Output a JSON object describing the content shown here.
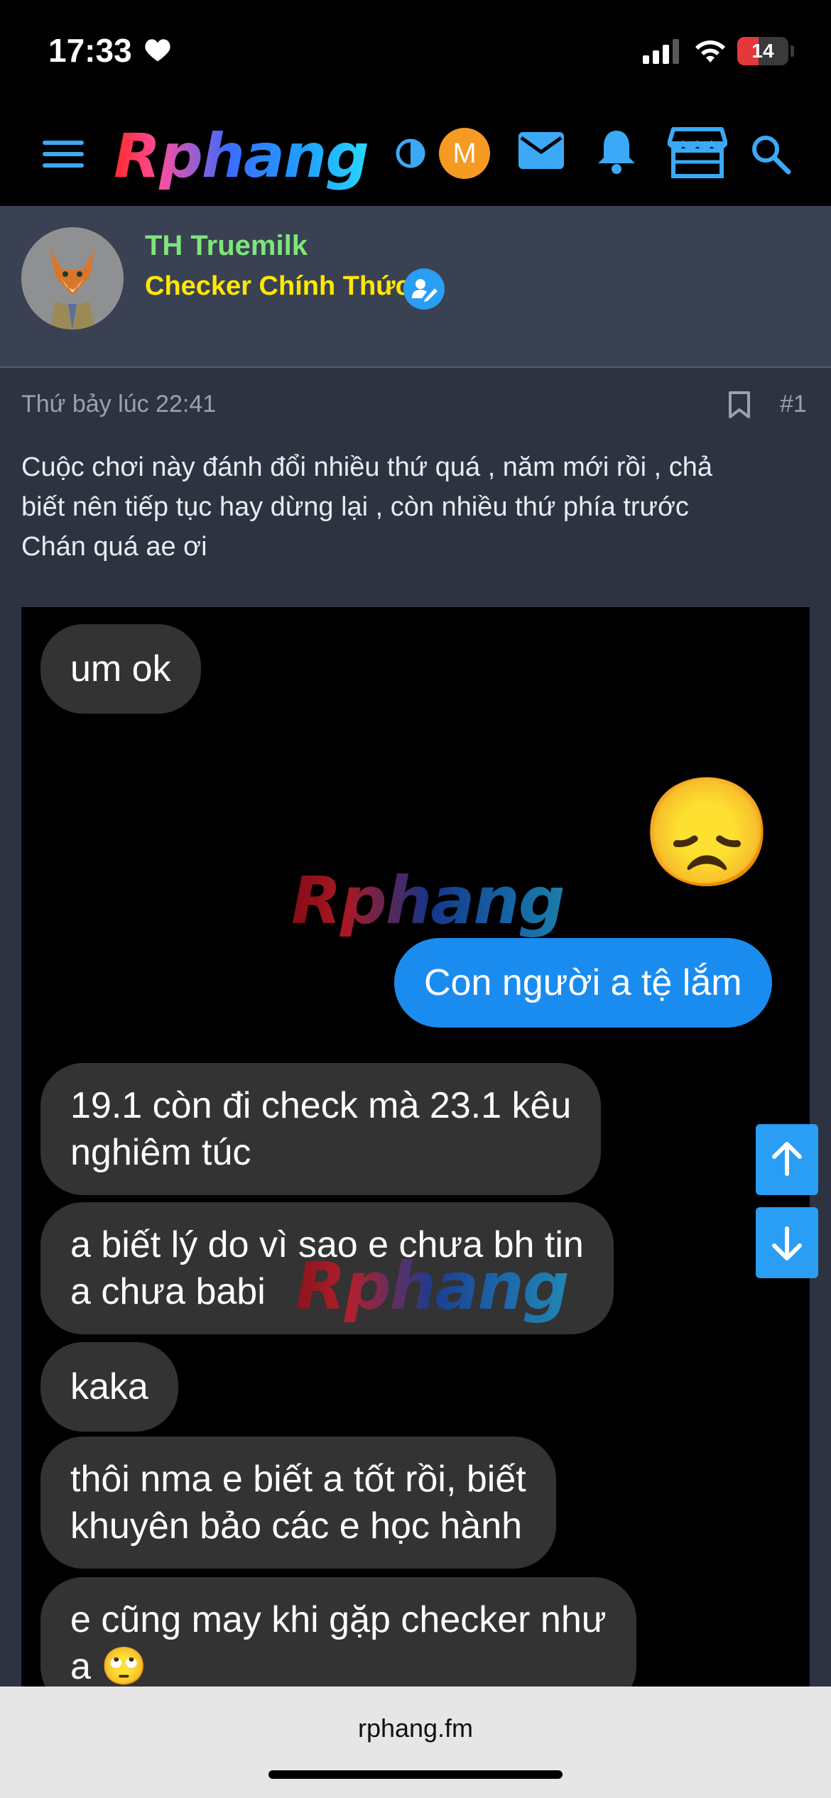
{
  "status_bar": {
    "time": "17:33",
    "battery": "14",
    "battery_level": 0.14
  },
  "header": {
    "logo": "Rphang",
    "user_avatar_letter": "M",
    "icons": [
      "menu-icon",
      "theme-toggle-icon",
      "mail-icon",
      "bell-icon",
      "store-icon",
      "search-icon"
    ]
  },
  "user": {
    "name": "TH Truemilk",
    "role": "Checker Chính Thức"
  },
  "post": {
    "timestamp": "Thứ bảy lúc 22:41",
    "number": "#1",
    "text_lines": [
      "Cuộc chơi này đánh đổi nhiều thứ quá , năm mới rồi , chả",
      "biết nên tiếp tục hay dừng lại , còn nhiều thứ phía trước",
      "Chán quá ae ơi"
    ]
  },
  "chat": {
    "received_1": "um ok",
    "sticker": "😞",
    "sent_1": "Con người a tệ lắm",
    "received_2_line1": "19.1 còn đi check mà 23.1 kêu",
    "received_2_line2": "nghiêm túc",
    "received_3_line1": "a biết lý do vì sao e chưa bh tin",
    "received_3_line2": "a chưa babi",
    "received_4": "kaka",
    "received_5_line1": "thôi nma e biết a tốt rồi, biết",
    "received_5_line2": "khuyên bảo các e học hành",
    "received_6_line1": "e cũng may khi gặp checker như",
    "received_6_line2": "a 🙄",
    "watermark": "Rphang"
  },
  "browser": {
    "url": "rphang.fm"
  },
  "colors": {
    "accent": "#2a9df4",
    "username": "#7de67a",
    "role": "#ffe800",
    "sent_bubble": "#1a8cf0"
  }
}
